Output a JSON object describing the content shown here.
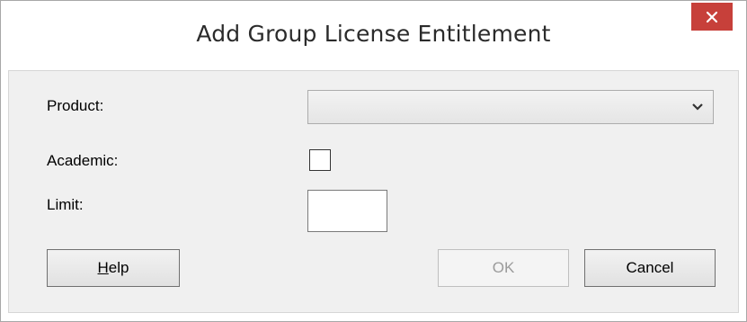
{
  "dialog": {
    "title": "Add Group License Entitlement"
  },
  "form": {
    "product_label": "Product:",
    "product_value": "",
    "academic_label": "Academic:",
    "academic_checked": false,
    "limit_label": "Limit:",
    "limit_value": ""
  },
  "buttons": {
    "help_first": "H",
    "help_rest": "elp",
    "ok": "OK",
    "cancel": "Cancel"
  },
  "icons": {
    "close": "close-icon",
    "dropdown": "chevron-down-icon"
  },
  "colors": {
    "close_bg": "#c7403a",
    "content_bg": "#f0f0f0",
    "disabled_text": "#9b9b9b"
  }
}
